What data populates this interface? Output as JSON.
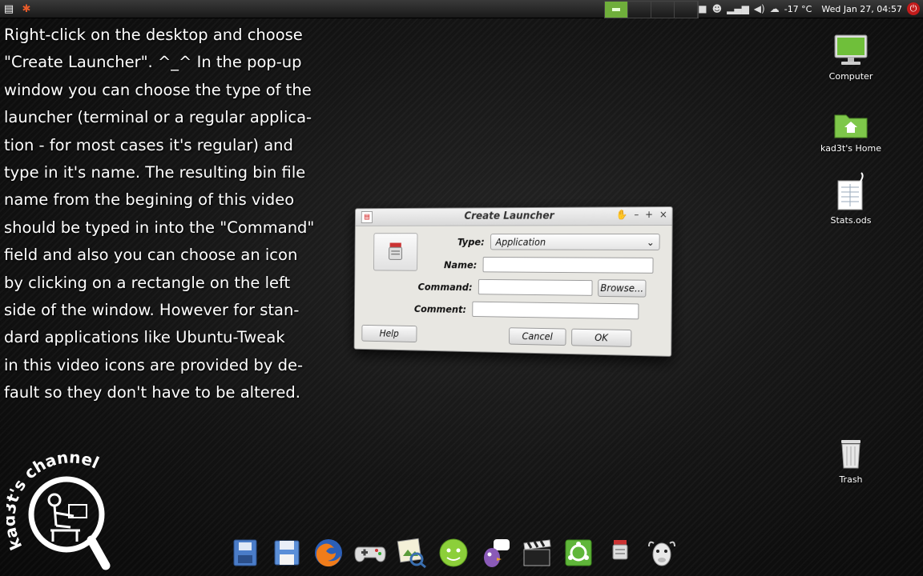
{
  "panel": {
    "clock": "Wed Jan 27, 04:57",
    "temperature": "-17 °C"
  },
  "tutorial": {
    "lines": [
      "Right-click on the desktop and choose",
      "\"Create Launcher\". ^_^ In the pop-up",
      "window you can choose the type of the",
      "launcher (terminal or a regular applica-",
      "tion - for most cases it's regular) and",
      "type in it's name. The resulting bin file",
      "name from the begining of this video",
      "should be typed in into the \"Command\"",
      "field and also you can choose an icon",
      "by clicking on a rectangle on the left",
      "side of the window. However for stan-",
      "dard applications like Ubuntu-Tweak",
      "in this video icons are provided by de-",
      "fault so they don't have to be altered."
    ]
  },
  "desktop_icons": [
    {
      "label": "Computer",
      "icon": "computer-icon"
    },
    {
      "label": "kad3t's Home",
      "icon": "home-folder-icon"
    },
    {
      "label": "Stats.ods",
      "icon": "spreadsheet-icon"
    },
    {
      "label": "Trash",
      "icon": "trash-icon"
    }
  ],
  "dialog": {
    "title": "Create Launcher",
    "type_label": "Type:",
    "type_value": "Application",
    "name_label": "Name:",
    "name_value": "",
    "command_label": "Command:",
    "command_value": "",
    "comment_label": "Comment:",
    "comment_value": "",
    "browse_label": "Browse...",
    "help_label": "Help",
    "cancel_label": "Cancel",
    "ok_label": "OK"
  },
  "watermark": "kad3t's channel",
  "colors": {
    "workspace_active": "#6fae3b",
    "power_button": "#c21b1b",
    "dialog_bg": "#e8e7e2"
  }
}
